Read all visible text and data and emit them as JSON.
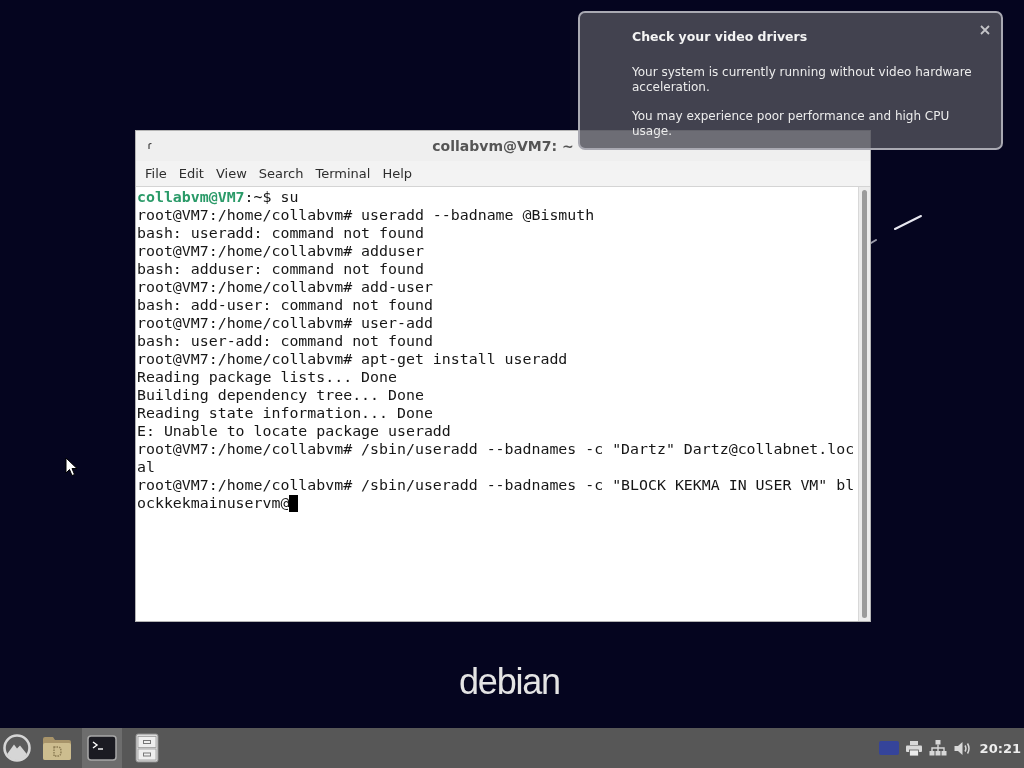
{
  "notification": {
    "title": "Check your video drivers",
    "paragraphs": [
      "Your system is currently running without video hardware acceleration.",
      "You may experience poor performance and high CPU usage."
    ]
  },
  "terminal": {
    "title": "collabvm@VM7: ~",
    "menu": [
      "File",
      "Edit",
      "View",
      "Search",
      "Terminal",
      "Help"
    ],
    "lines": [
      {
        "kind": "user_prompt",
        "user": "collabvm@VM7",
        "text": ":~$ su",
        "cursor": false
      },
      {
        "kind": "plain",
        "text": "root@VM7:/home/collabvm# useradd --badname @Bismuth",
        "cursor": false
      },
      {
        "kind": "plain",
        "text": "bash: useradd: command not found",
        "cursor": false
      },
      {
        "kind": "plain",
        "text": "root@VM7:/home/collabvm# adduser",
        "cursor": false
      },
      {
        "kind": "plain",
        "text": "bash: adduser: command not found",
        "cursor": false
      },
      {
        "kind": "plain",
        "text": "root@VM7:/home/collabvm# add-user",
        "cursor": false
      },
      {
        "kind": "plain",
        "text": "bash: add-user: command not found",
        "cursor": false
      },
      {
        "kind": "plain",
        "text": "root@VM7:/home/collabvm# user-add",
        "cursor": false
      },
      {
        "kind": "plain",
        "text": "bash: user-add: command not found",
        "cursor": false
      },
      {
        "kind": "plain",
        "text": "root@VM7:/home/collabvm# apt-get install useradd",
        "cursor": false
      },
      {
        "kind": "plain",
        "text": "Reading package lists... Done",
        "cursor": false
      },
      {
        "kind": "plain",
        "text": "Building dependency tree... Done",
        "cursor": false
      },
      {
        "kind": "plain",
        "text": "Reading state information... Done",
        "cursor": false
      },
      {
        "kind": "plain",
        "text": "E: Unable to locate package useradd",
        "cursor": false
      },
      {
        "kind": "plain",
        "text": "root@VM7:/home/collabvm# /sbin/useradd --badnames -c \"Dartz\" Dartz@collabnet.loc",
        "cursor": false
      },
      {
        "kind": "plain",
        "text": "al",
        "cursor": false
      },
      {
        "kind": "plain",
        "text": "root@VM7:/home/collabvm# /sbin/useradd --badnames -c \"BLOCK KEKMA IN USER VM\" bl",
        "cursor": false
      },
      {
        "kind": "plain",
        "text": "ockkekmainuservm@",
        "cursor": true
      }
    ]
  },
  "desktop": {
    "logo": "debian"
  },
  "taskbar": {
    "launchers": [
      {
        "kind": "start",
        "selected": false
      },
      {
        "kind": "folder",
        "selected": false
      },
      {
        "kind": "terminal",
        "selected": true
      },
      {
        "kind": "cabinet",
        "selected": false
      }
    ],
    "tray": [
      {
        "kind": "layout"
      },
      {
        "kind": "printer"
      },
      {
        "kind": "network"
      },
      {
        "kind": "volume"
      }
    ],
    "clock": "20:21"
  }
}
